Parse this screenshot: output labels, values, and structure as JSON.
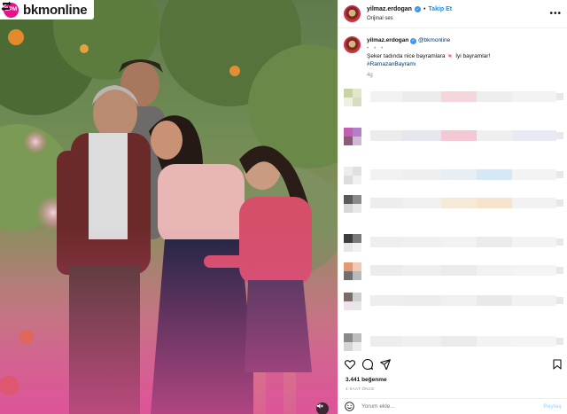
{
  "watermark": {
    "brand_badge": "BPM",
    "brand_name": "bkmonline"
  },
  "post": {
    "username": "yilmaz.erdogan",
    "follow_separator": "•",
    "follow_label": "Takip Et",
    "audio_label": "Orijinal ses",
    "more_icon": "more-horizontal-icon"
  },
  "caption": {
    "username": "yilmaz.erdogan",
    "mention": "@bkmonline",
    "dots": "• • •",
    "text": "Şeker tadında nice bayramlara 🍬 İyi bayramlar!",
    "hashtag": "#RamazanBayramı",
    "time_ago": "4g"
  },
  "actions": {
    "like_icon": "heart-icon",
    "comment_icon": "comment-icon",
    "share_icon": "send-icon",
    "save_icon": "bookmark-icon"
  },
  "likes_text": "3.441 beğenme",
  "date_text": "4 SAAT ÖNCE",
  "comment_box": {
    "placeholder": "Yorum ekle...",
    "post_label": "Paylaş",
    "emoji_icon": "emoji-icon"
  },
  "colors": {
    "accent": "#0095f6",
    "verified": "#3897f0",
    "brand_pink": "#e5128c"
  },
  "comments": [
    {
      "avatar": [
        "#c8d3a4",
        "#e3e6c8",
        "#eef0e0",
        "#d8dcc0"
      ],
      "blur": [
        "#f2f2f2",
        "#ececec",
        "#f4d7dc",
        "#eeeeee",
        "#f3f3f3"
      ]
    },
    {
      "avatar": [
        "#c25fb1",
        "#b27fc8",
        "#8a5b78",
        "#d2b7d6"
      ],
      "blur": [
        "#ececec",
        "#e6e6ee",
        "#f5c8d5",
        "#efefef",
        "#e9e9f3"
      ]
    },
    {
      "avatar": [
        "#ececec",
        "#e0e0e0",
        "#dddddd",
        "#f0f0f0"
      ],
      "blur": [
        "#f2f2f2",
        "#efefef",
        "#e7eef4",
        "#d6e8f6",
        "#f3f3f3"
      ]
    },
    {
      "avatar": [
        "#5a5a5a",
        "#8a8a8a",
        "#d7d7d7",
        "#e8e8e8"
      ],
      "blur": [
        "#ededed",
        "#f0f0f0",
        "#f4ead6",
        "#f6e4cf",
        "#f2f2f2"
      ]
    },
    {
      "avatar": [
        "#3d3d3d",
        "#7a7a7a",
        "#e6e6e6",
        "#f1f1f1"
      ],
      "blur": [
        "#eeeeee",
        "#f0f0f0",
        "#f2f2f2",
        "#ebebeb",
        "#f3f3f3"
      ]
    },
    {
      "avatar": [
        "#e29a74",
        "#f2c9b0",
        "#6f6f6f",
        "#b9b9b9"
      ],
      "blur": [
        "#ececec",
        "#efefef",
        "#ebebeb",
        "#f2f2f2",
        "#f4f4f4"
      ]
    },
    {
      "avatar": [
        "#7a6a68",
        "#cfcfcf",
        "#f0e0ec",
        "#e6e6e6"
      ],
      "blur": [
        "#eeeeee",
        "#ededed",
        "#f0f0f0",
        "#e9e9e9",
        "#f2f2f2"
      ]
    },
    {
      "avatar": [
        "#8a8a8a",
        "#bdbdbd",
        "#d4d4d4",
        "#ececec"
      ],
      "blur": [
        "#ededed",
        "#f0f0f0",
        "#ebebeb",
        "#f3f3f3",
        "#f4f4f4"
      ]
    }
  ]
}
